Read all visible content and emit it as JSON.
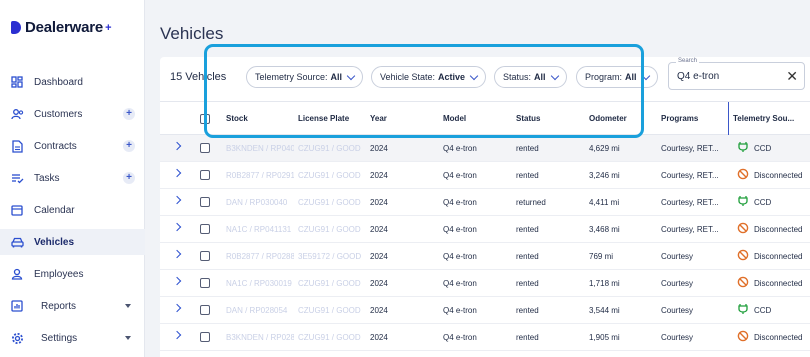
{
  "app": {
    "name": "Dealerware",
    "plus": "+"
  },
  "sidebar": {
    "items": [
      {
        "label": "Dashboard",
        "icon": "dashboard-icon"
      },
      {
        "label": "Customers",
        "icon": "customers-icon",
        "add": "+"
      },
      {
        "label": "Contracts",
        "icon": "contracts-icon",
        "add": "+"
      },
      {
        "label": "Tasks",
        "icon": "tasks-icon",
        "add": "+"
      },
      {
        "label": "Calendar",
        "icon": "calendar-icon"
      },
      {
        "label": "Vehicles",
        "icon": "car-icon",
        "active": true
      },
      {
        "label": "Employees",
        "icon": "employees-icon"
      },
      {
        "label": "Reports",
        "icon": "reports-icon"
      },
      {
        "label": "Settings",
        "icon": "gear-icon"
      }
    ]
  },
  "page": {
    "title": "Vehicles"
  },
  "toolbar": {
    "count": "15 Vehicles",
    "filters": [
      {
        "label": "Telemetry Source:",
        "value": "All"
      },
      {
        "label": "Vehicle State:",
        "value": "Active"
      },
      {
        "label": "Status:",
        "value": "All"
      },
      {
        "label": "Program:",
        "value": "All"
      }
    ],
    "search": {
      "label": "Search",
      "value": "Q4 e-tron",
      "clear": "✕"
    }
  },
  "table": {
    "columns": [
      "Stock",
      "License Plate",
      "Year",
      "Model",
      "Status",
      "Odometer",
      "Programs",
      "Telemetry Sou..."
    ],
    "rows": [
      {
        "stock": "B3KNDEN / RP040",
        "plate": "CZUG91 / GOOD",
        "year": "2024",
        "model": "Q4 e-tron",
        "status": "rented",
        "odometer": "4,629 mi",
        "programs": "Courtesy, RET...",
        "telemetry": "CCD",
        "tel_type": "ccd"
      },
      {
        "stock": "R0B2877 / RP0291",
        "plate": "CZUG91 / GOOD",
        "year": "2024",
        "model": "Q4 e-tron",
        "status": "rented",
        "odometer": "3,246 mi",
        "programs": "Courtesy, RET...",
        "telemetry": "Disconnected",
        "tel_type": "disc"
      },
      {
        "stock": "DAN / RP030040",
        "plate": "CZUG91 / GOOD",
        "year": "2024",
        "model": "Q4 e-tron",
        "status": "returned",
        "odometer": "4,411 mi",
        "programs": "Courtesy, RET...",
        "telemetry": "CCD",
        "tel_type": "ccd"
      },
      {
        "stock": "NA1C / RP041131",
        "plate": "CZUG91 / GOOD",
        "year": "2024",
        "model": "Q4 e-tron",
        "status": "rented",
        "odometer": "3,468 mi",
        "programs": "Courtesy, RET...",
        "telemetry": "Disconnected",
        "tel_type": "disc"
      },
      {
        "stock": "R0B2877 / RP0288",
        "plate": "3E59172 / GOOD",
        "year": "2024",
        "model": "Q4 e-tron",
        "status": "rented",
        "odometer": "769 mi",
        "programs": "Courtesy",
        "telemetry": "Disconnected",
        "tel_type": "disc"
      },
      {
        "stock": "NA1C / RP030019",
        "plate": "CZUG91 / GOOD",
        "year": "2024",
        "model": "Q4 e-tron",
        "status": "rented",
        "odometer": "1,718 mi",
        "programs": "Courtesy",
        "telemetry": "Disconnected",
        "tel_type": "disc"
      },
      {
        "stock": "DAN / RP028054",
        "plate": "CZUG91 / GOOD",
        "year": "2024",
        "model": "Q4 e-tron",
        "status": "rented",
        "odometer": "3,544 mi",
        "programs": "Courtesy",
        "telemetry": "CCD",
        "tel_type": "ccd"
      },
      {
        "stock": "B3KNDEN / RP0281",
        "plate": "CZUG91 / GOOD",
        "year": "2024",
        "model": "Q4 e-tron",
        "status": "rented",
        "odometer": "1,905 mi",
        "programs": "Courtesy",
        "telemetry": "Disconnected",
        "tel_type": "disc"
      }
    ]
  },
  "colors": {
    "accent": "#2b4fcf",
    "highlight": "#1aa0dc",
    "ccd": "#1e9e3a",
    "disconnected": "#e0702a"
  }
}
